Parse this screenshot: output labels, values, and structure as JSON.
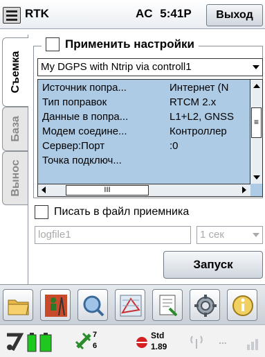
{
  "titlebar": {
    "app_title": "RTK",
    "mode": "AC",
    "time": "5:41P",
    "exit_label": "Выход"
  },
  "tabs": [
    {
      "label": "Съемка",
      "active": true
    },
    {
      "label": "База",
      "active": false
    },
    {
      "label": "Вынос",
      "active": false
    }
  ],
  "settings": {
    "apply_label": "Применить настройки",
    "apply_checked": false,
    "profile_value": "My DGPS with Ntrip via controll1",
    "properties": [
      {
        "name": "Источник попра...",
        "value": "Интернет (N"
      },
      {
        "name": "Тип поправок",
        "value": "RTCM 2.x"
      },
      {
        "name": "Данные в попра...",
        "value": "L1+L2, GNSS"
      },
      {
        "name": "Модем соедине...",
        "value": "Контроллер"
      },
      {
        "name": "Сервер:Порт",
        "value": ":0"
      },
      {
        "name": "Точка подключ...",
        "value": ""
      }
    ]
  },
  "logging": {
    "write_label": "Писать в файл приемника",
    "write_checked": false,
    "filename_placeholder": "logfile1",
    "interval_value": "1 сек"
  },
  "actions": {
    "run_label": "Запуск"
  },
  "toolbar": {
    "buttons": [
      {
        "icon": "folder-icon"
      },
      {
        "icon": "surveyor-icon"
      },
      {
        "icon": "magnifier-icon"
      },
      {
        "icon": "cogo-icon"
      },
      {
        "icon": "document-icon"
      },
      {
        "icon": "gear-icon"
      },
      {
        "icon": "info-icon"
      }
    ]
  },
  "status": {
    "satellites_top": "7",
    "satellites_bottom": "6",
    "solution_type": "Std",
    "precision": "1.89",
    "more": "..."
  },
  "colors": {
    "list_bg": "#aecbe6",
    "battery": "#1ec81e",
    "sat": "#2a8c2a",
    "accent_red": "#d42020"
  }
}
